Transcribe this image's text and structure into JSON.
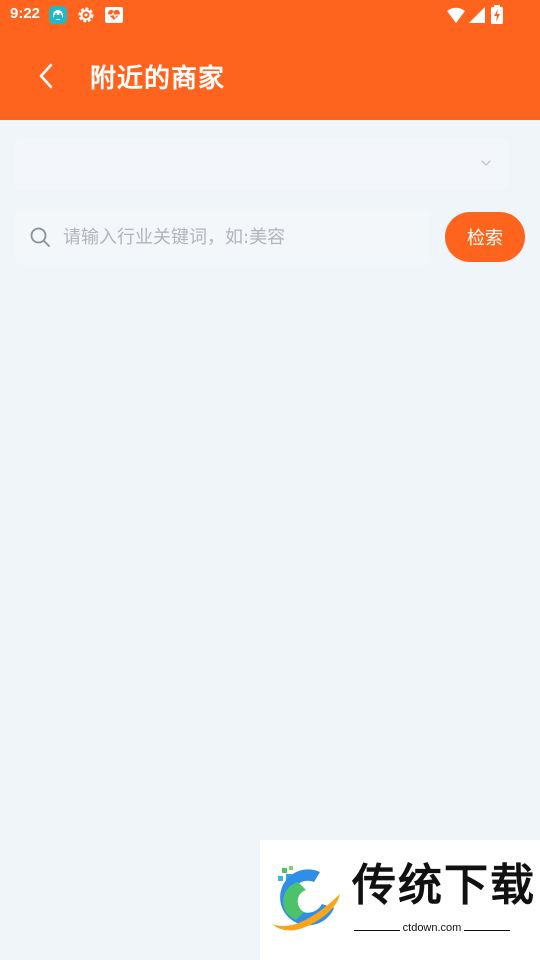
{
  "status_bar": {
    "time": "9:22"
  },
  "header": {
    "title": "附近的商家"
  },
  "filter": {
    "selected": ""
  },
  "search": {
    "placeholder": "请输入行业关键词，如:美容",
    "value": "",
    "button_label": "检索"
  },
  "watermark": {
    "brand": "传统下载",
    "site": "ctdown.com"
  },
  "colors": {
    "accent": "#ff641e",
    "background": "#f0f5fa",
    "input_background": "#f4f7fa"
  }
}
